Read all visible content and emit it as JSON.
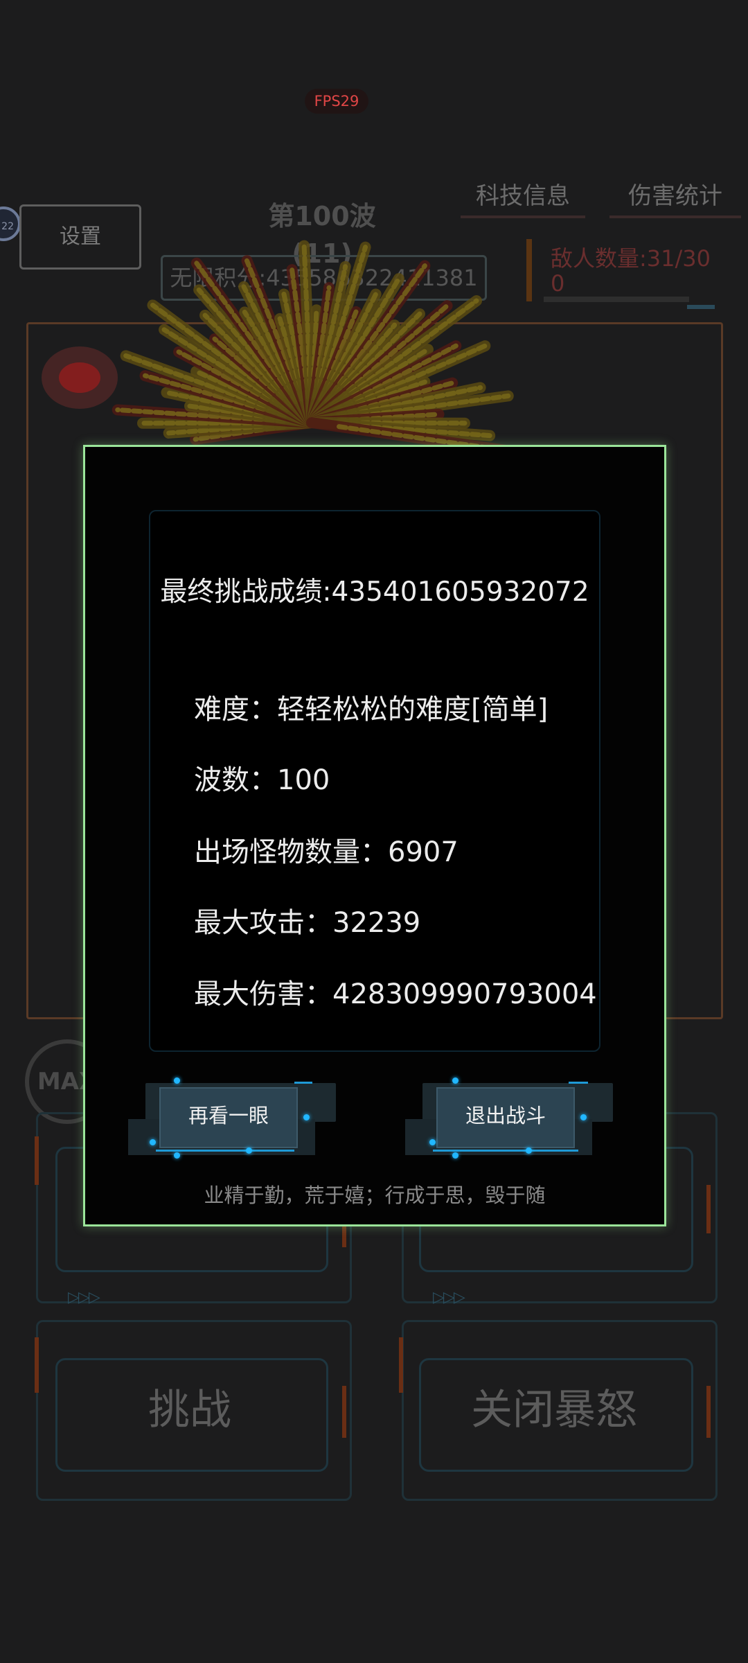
{
  "hud": {
    "fps": "FPS29",
    "tech_tab": "科技信息",
    "damage_tab": "伤害统计",
    "settings": "设置",
    "level_badge": "22",
    "wave_title": "第100波(11)",
    "infinite_score": "无限积分:435586322411381",
    "enemy_count": "敌人数量:31/300",
    "max_badge": "MAX"
  },
  "bottom_buttons": {
    "challenge": "挑战",
    "close_rage": "关闭暴怒"
  },
  "dialog": {
    "final_score": "最终挑战成绩:435401605932072",
    "stats": [
      {
        "label": "难度",
        "value": "轻轻松松的难度[简单]"
      },
      {
        "label": "波数",
        "value": "100"
      },
      {
        "label": "出场怪物数量",
        "value": "6907"
      },
      {
        "label": "最大攻击",
        "value": "32239"
      },
      {
        "label": "最大伤害",
        "value": "428309990793004"
      }
    ],
    "separator": "：",
    "buttons": {
      "review": "再看一眼",
      "exit": "退出战斗"
    },
    "motto": "业精于勤，荒于嬉；行成于思，毁于随"
  },
  "colors": {
    "dialog_border": "#9be59a",
    "accent_blue": "#21b7ff",
    "fps_red": "#e04646"
  }
}
